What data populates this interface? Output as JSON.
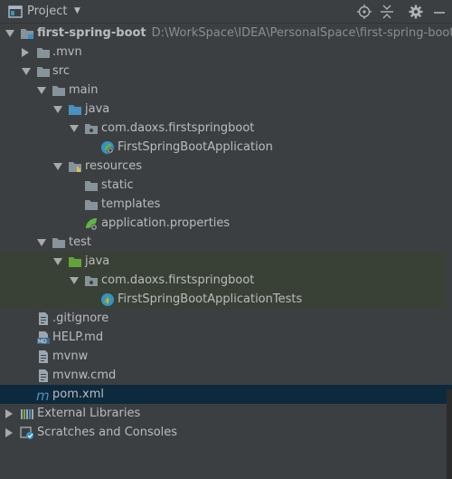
{
  "header": {
    "title": "Project",
    "icons": [
      "project-view-icon",
      "locate-icon",
      "collapse-all-icon",
      "settings-gear-icon",
      "hide-icon"
    ]
  },
  "tree": {
    "root": {
      "label": "first-spring-boot",
      "path": "D:\\WorkSpace\\IDEA\\PersonalSpace\\first-spring-boot"
    },
    "mvn": "mvn",
    "src": "src",
    "main": "main",
    "main_java": "java",
    "main_pkg": "com.daoxs.firstspringboot",
    "main_class": "FirstSpringBootApplication",
    "resources": "resources",
    "static": "static",
    "templates": "templates",
    "app_props": "application.properties",
    "test": "test",
    "test_java": "java",
    "test_pkg": "com.daoxs.firstspringboot",
    "test_class": "FirstSpringBootApplicationTests",
    "gitignore": ".gitignore",
    "help": "HELP.md",
    "mvnw": "mvnw",
    "mvnw_cmd": "mvnw.cmd",
    "pom": "pom.xml",
    "external": "External Libraries",
    "scratches": "Scratches and Consoles"
  },
  "colors": {
    "background": "#3c3f41",
    "selected_row": "#0d293e",
    "test_row": "#394036",
    "folder": "#87939a",
    "source_folder": "#4a90c2",
    "test_folder": "#62a33b",
    "text": "#bbbbbb"
  }
}
